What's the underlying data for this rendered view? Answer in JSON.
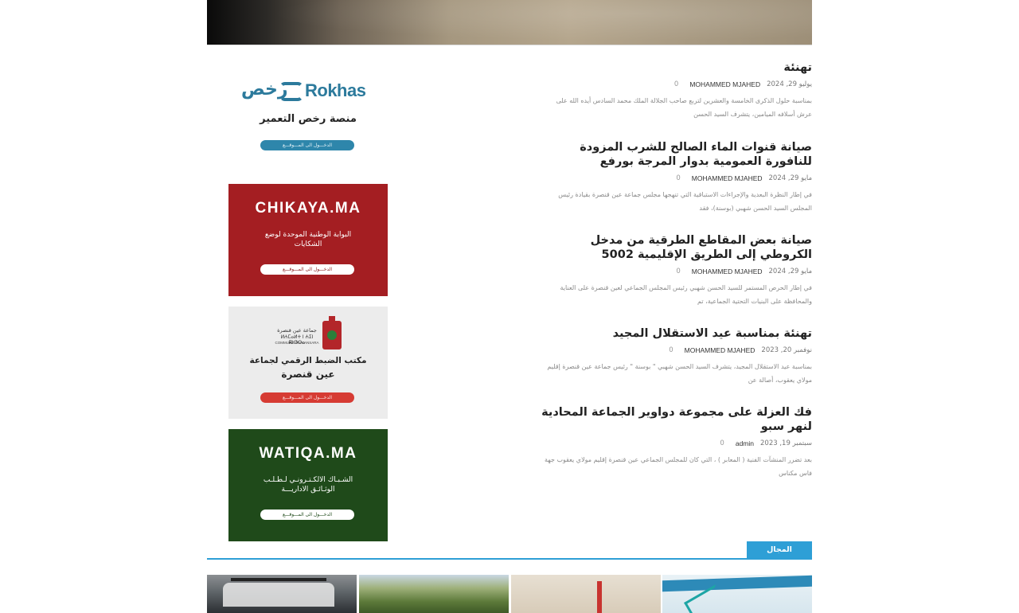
{
  "posts": [
    {
      "title": "تهنئة",
      "date": "يوليو 29, 2024",
      "author": "MOHAMMED MJAHED",
      "comments": "0",
      "excerpt": "بمناسبة حلول الذكرى الخامسة والعشرين لتربع صاحب الجلالة الملك محمد السادس أيده الله على عرش أسلافه الميامين، يتشرف السيد الحسن"
    },
    {
      "title": "صيانة قنوات الماء الصالح للشرب المزودة للنافورة العمومية بدوار المرجة بورفع",
      "date": "مايو 29, 2024",
      "author": "MOHAMMED MJAHED",
      "comments": "0",
      "excerpt": "في إطار النظرة البعدية والإجراءات الاستباقية التي تنهجها مجلس جماعة عين قنصرة بقيادة رئيس المجلس السيد الحسن شهبي (بوسنة)، فقد"
    },
    {
      "title": "صيانة بعض المقاطع الطرقية من مدخل الكروطي إلى الطريق الإقليمية 5002",
      "date": "مايو 29, 2024",
      "author": "MOHAMMED MJAHED",
      "comments": "0",
      "excerpt": "في إطار الحرص المستمر للسيد الحسن شهبي رئيس المجلس الجماعي لعين قنصرة على العناية والمحافظة على البنيات التحتية الجماعية، تم"
    },
    {
      "title": "تهنئة بمناسبة عيد الاستقلال المجيد",
      "date": "نوفمبر 20, 2023",
      "author": "MOHAMMED MJAHED",
      "comments": "0",
      "excerpt": "بمناسبة عيد الاستقلال المجيد، يتشرف السيد الحسن شهبي \" بوسنة \" رئيس جماعة عين قنصرة إقليم مولاي يعقوب، أصالة عن"
    },
    {
      "title": "فك العزلة على مجموعة دواوير الجماعة المحادية لنهر سبو",
      "date": "سبتمبر 19, 2023",
      "author": "admin",
      "comments": "0",
      "excerpt": "بعد تضرر المنشآت الفنية ( المعابر ) ، التي كان للمجلس الجماعي عين قنصرة إقليم مولاي يعقوب جهة فاس مكناس"
    }
  ],
  "sidebar": {
    "rokhas": {
      "logo_ar": "رخص",
      "logo_en": "Rokhas",
      "subtitle": "منصة رخص التعمير",
      "button": "الدخـــول الى المـــوقـــع",
      "color": "#2e86ab"
    },
    "chikaya": {
      "title": "CHIKAYA.MA",
      "subtitle": "البوابة الوطنية الموحدة لوضع الشكايات",
      "button": "الدخـــول الى المـــوقـــع",
      "color": "#a41e22"
    },
    "commune": {
      "logo_ar": "جماعة عين قنصرة",
      "logo_tf": "ⵍⵄⵎⴰⵍⵜ ⵏ ⵄⵉⵏ ⴽⵏⵚⵔⴰ",
      "logo_fr": "COMMUNE AIN KANSARA",
      "line1": "مكتب الضبط الرقمي لجماعة",
      "line2": "عين قنصرة",
      "button": "الدخـــول الى المـــوقـــع",
      "color": "#d63b33"
    },
    "watiqa": {
      "title": "WATIQA.MA",
      "subtitle": "الشـبـاك الالكـتـرونـي لـطـلـب الوثـائـق الاداريـــة",
      "button": "الدخـــول الى المـــوقـــع",
      "color": "#1f4a1a"
    }
  },
  "section": {
    "label": "المجال الاقتصادي",
    "color": "#2e9fd6"
  }
}
